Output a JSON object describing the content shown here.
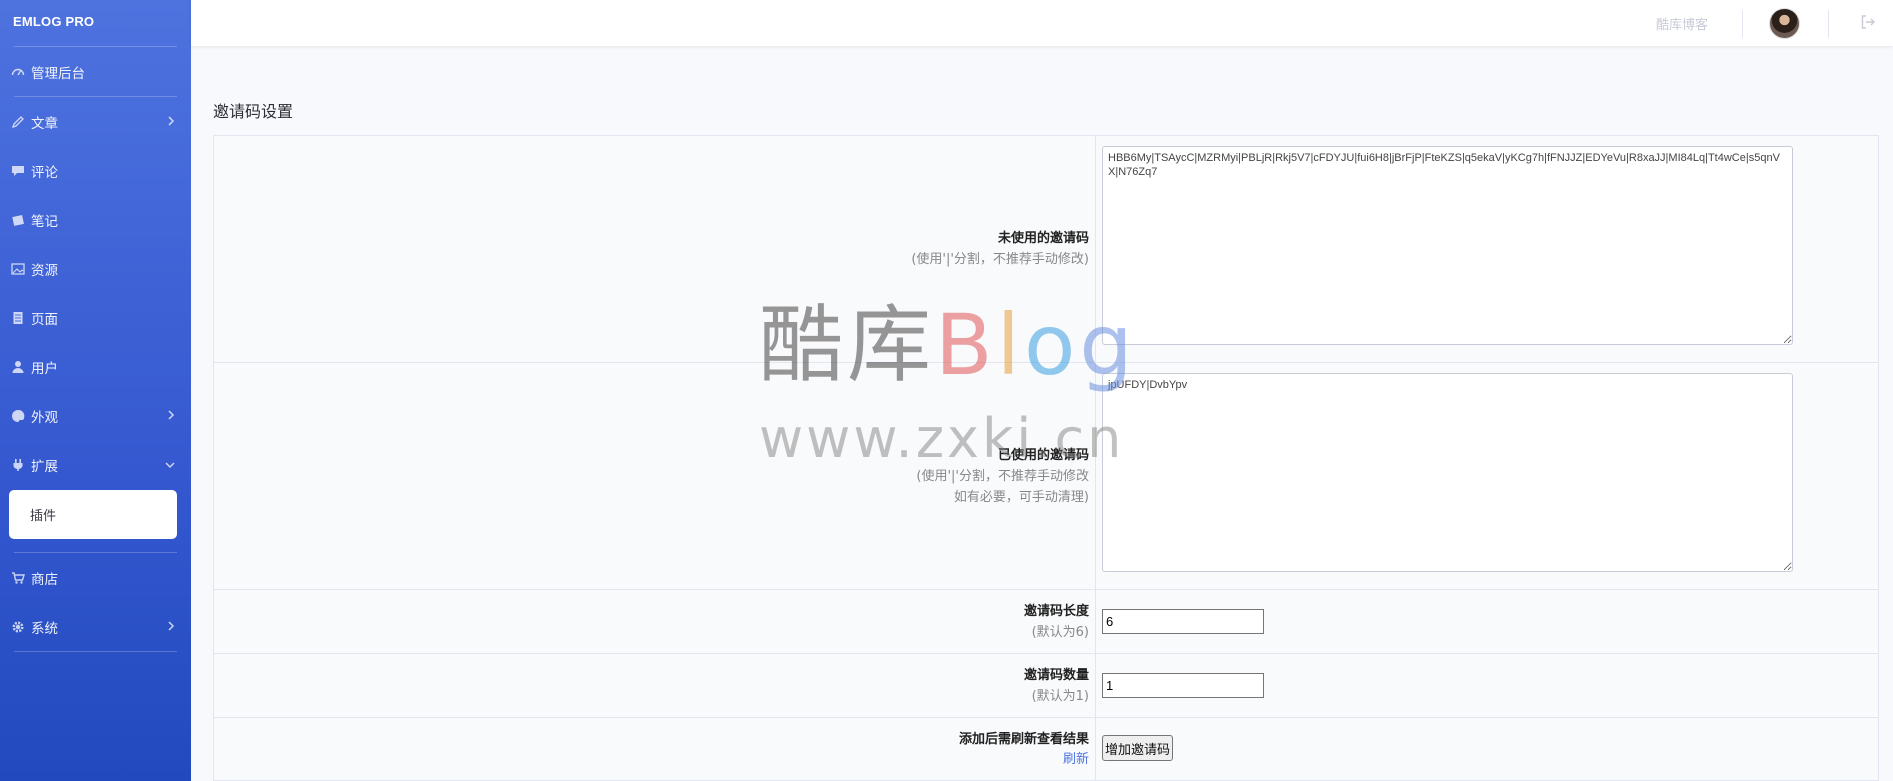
{
  "brand": "EMLOG PRO",
  "sidebar": {
    "items": [
      {
        "label": "管理后台",
        "icon": "dashboard-icon"
      },
      {
        "label": "文章",
        "icon": "pencil-icon",
        "chevron": "right"
      },
      {
        "label": "评论",
        "icon": "comment-icon"
      },
      {
        "label": "笔记",
        "icon": "note-icon"
      },
      {
        "label": "资源",
        "icon": "image-icon"
      },
      {
        "label": "页面",
        "icon": "page-icon"
      },
      {
        "label": "用户",
        "icon": "user-icon"
      },
      {
        "label": "外观",
        "icon": "palette-icon",
        "chevron": "right"
      },
      {
        "label": "扩展",
        "icon": "plug-icon",
        "chevron": "down"
      },
      {
        "label": "商店",
        "icon": "cart-icon"
      },
      {
        "label": "系统",
        "icon": "gear-icon",
        "chevron": "right"
      }
    ],
    "sub_item": "插件"
  },
  "topbar": {
    "site_link": "酷库博客",
    "avatar": "avatar",
    "logout_icon": "logout-icon"
  },
  "main": {
    "title": "邀请码设置",
    "rows": {
      "unused": {
        "label": "未使用的邀请码",
        "hint": "(使用'|'分割，不推荐手动修改)",
        "value": "HBB6My|TSAycC|MZRMyi|PBLjR|Rkj5V7|cFDYJU|fui6H8|jBrFjP|FteKZS|q5ekaV|yKCg7h|fFNJJZ|EDYeVu|R8xaJJ|MI84Lq|Tt4wCe|s5qnVX|N76Zq7"
      },
      "used": {
        "label": "已使用的邀请码",
        "hint1": "(使用'|'分割，不推荐手动修改",
        "hint2": "如有必要，可手动清理)",
        "value": "jpUFDY|DvbYpv"
      },
      "length": {
        "label": "邀请码长度",
        "hint": "(默认为6)",
        "value": "6"
      },
      "count": {
        "label": "邀请码数量",
        "hint": "(默认为1)",
        "value": "1"
      },
      "add": {
        "label": "添加后需刷新查看结果",
        "link": "刷新",
        "button": "增加邀请码"
      }
    }
  },
  "watermark": {
    "top_cn": "酷库",
    "top_en": [
      "B",
      "l",
      "o",
      "g"
    ],
    "bottom": "www.zxki.cn"
  },
  "colors": {
    "sidebar_top": "#4e73df",
    "sidebar_bottom": "#224abe",
    "link": "#4e73df"
  }
}
